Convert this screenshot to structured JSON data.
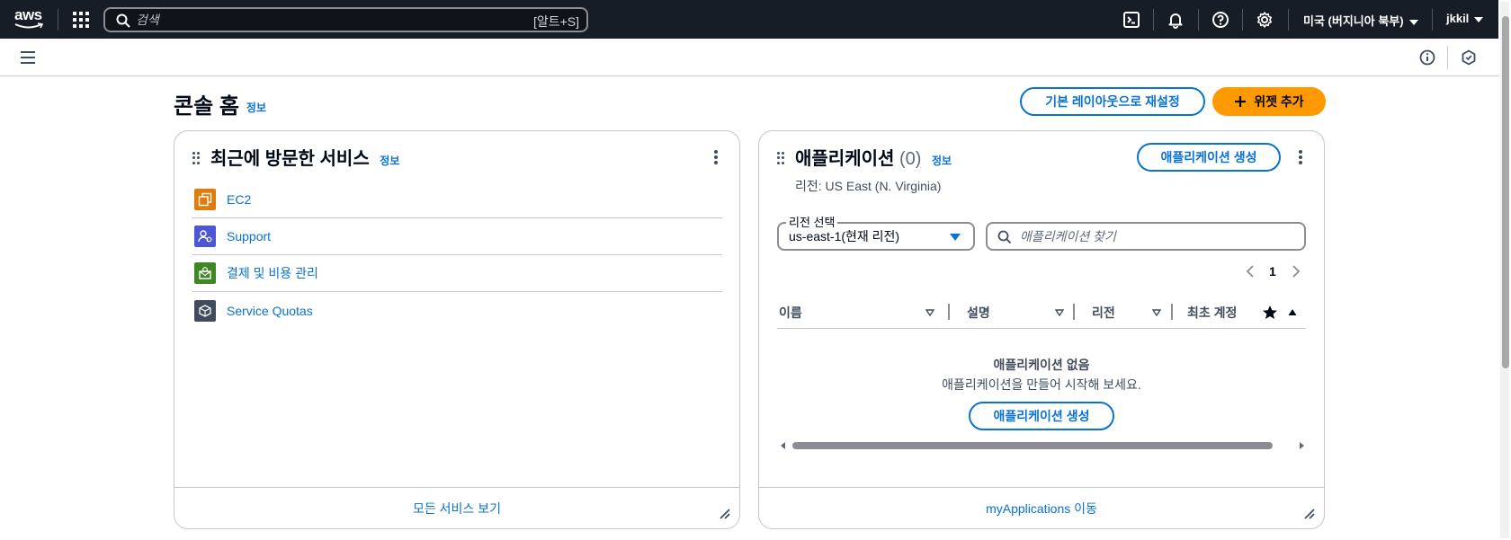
{
  "topbar": {
    "logo_text": "aws",
    "search_placeholder": "검색",
    "search_shortcut": "[알트+S]",
    "region": "미국 (버지니아 북부)",
    "user": "jkkil"
  },
  "page": {
    "title": "콘솔 홈",
    "info": "정보",
    "reset_layout": "기본 레이아웃으로 재설정",
    "add_widget": "위젯 추가"
  },
  "recent": {
    "title": "최근에 방문한 서비스",
    "info": "정보",
    "items": [
      {
        "label": "EC2",
        "color": "#e07b0d"
      },
      {
        "label": "Support",
        "color": "#4d56d6"
      },
      {
        "label": "결제 및 비용 관리",
        "color": "#3f8624"
      },
      {
        "label": "Service Quotas",
        "color": "#414d5c"
      }
    ],
    "footer": "모든 서비스 보기"
  },
  "apps": {
    "title": "애플리케이션",
    "count": "(0)",
    "info": "정보",
    "create_button": "애플리케이션 생성",
    "region_text": "리전: US East (N. Virginia)",
    "select_label": "리전 선택",
    "select_value": "us-east-1(현재 리전)",
    "find_placeholder": "애플리케이션 찾기",
    "page_number": "1",
    "columns": [
      "이름",
      "설명",
      "리전",
      "최초 계정"
    ],
    "empty_title": "애플리케이션 없음",
    "empty_desc": "애플리케이션을 만들어 시작해 보세요.",
    "empty_button": "애플리케이션 생성",
    "footer": "myApplications 이동"
  },
  "colors": {
    "topbar": "#161d26",
    "link": "#0972d3",
    "primary": "#ff9900"
  }
}
